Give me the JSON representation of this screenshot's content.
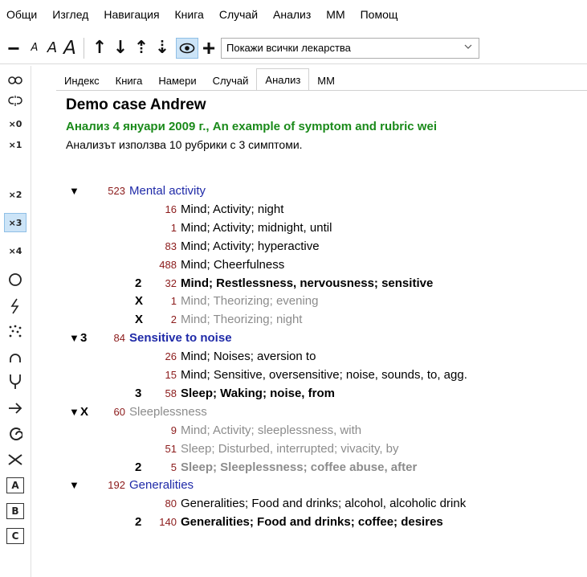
{
  "menu": [
    "Общи",
    "Изглед",
    "Навигация",
    "Книга",
    "Случай",
    "Анализ",
    "ММ",
    "Помощ"
  ],
  "toolbar": {
    "font_small": "A",
    "font_medium": "A",
    "font_large": "A",
    "filter_value": "Покажи всички лекарства",
    "icons": [
      "minus-icon",
      "font-small-icon",
      "font-medium-icon",
      "font-large-icon",
      "arrow-up-icon",
      "arrow-down-icon",
      "arrow-up-dotted-icon",
      "arrow-down-dotted-icon",
      "eye-icon",
      "plus-icon"
    ]
  },
  "leftbar": {
    "x0": "×0",
    "x1": "×1",
    "x2": "×2",
    "x3": "×3",
    "x4": "×4",
    "box_a": "A",
    "box_b": "B",
    "box_c": "C"
  },
  "tabs": [
    "Индекс",
    "Книга",
    "Намери",
    "Случай",
    "Анализ",
    "ММ"
  ],
  "active_tab": "Анализ",
  "case": {
    "title": "Demo case Andrew",
    "analysis": "Анализ 4 януари 2009 г., An example of symptom and rubric wei",
    "usage": "Анализът използва 10 рубрики с 3 симптоми."
  },
  "symptoms": [
    {
      "triangle": "▼",
      "weight": "",
      "count": "523",
      "label": "Mental activity",
      "style": "blue",
      "rubrics": [
        {
          "weight": "",
          "count": "16",
          "label": "Mind; Activity; night",
          "style": "normal"
        },
        {
          "weight": "",
          "count": "1",
          "label": "Mind; Activity; midnight, until",
          "style": "normal"
        },
        {
          "weight": "",
          "count": "83",
          "label": "Mind; Activity; hyperactive",
          "style": "normal"
        },
        {
          "weight": "",
          "count": "488",
          "label": "Mind; Cheerfulness",
          "style": "normal"
        },
        {
          "weight": "2",
          "count": "32",
          "label": "Mind; Restlessness, nervousness; sensitive",
          "style": "bold"
        },
        {
          "weight": "X",
          "count": "1",
          "label": "Mind; Theorizing; evening",
          "style": "grey"
        },
        {
          "weight": "X",
          "count": "2",
          "label": "Mind; Theorizing; night",
          "style": "grey"
        }
      ]
    },
    {
      "triangle": "▼",
      "weight": "3",
      "count": "84",
      "label": "Sensitive to noise",
      "style": "blue-bold",
      "rubrics": [
        {
          "weight": "",
          "count": "26",
          "label": "Mind; Noises; aversion to",
          "style": "normal"
        },
        {
          "weight": "",
          "count": "15",
          "label": "Mind; Sensitive, oversensitive; noise, sounds, to, agg.",
          "style": "normal"
        },
        {
          "weight": "3",
          "count": "58",
          "label": "Sleep; Waking; noise, from",
          "style": "bold"
        }
      ]
    },
    {
      "triangle": "▼",
      "weight": "X",
      "count": "60",
      "label": "Sleeplessness",
      "style": "grey",
      "rubrics": [
        {
          "weight": "",
          "count": "9",
          "label": "Mind; Activity; sleeplessness, with",
          "style": "grey"
        },
        {
          "weight": "",
          "count": "51",
          "label": "Sleep; Disturbed, interrupted; vivacity, by",
          "style": "grey"
        },
        {
          "weight": "2",
          "count": "5",
          "label": "Sleep; Sleeplessness; coffee abuse, after",
          "style": "grey-bold"
        }
      ]
    },
    {
      "triangle": "▼",
      "weight": "",
      "count": "192",
      "label": "Generalities",
      "style": "blue",
      "rubrics": [
        {
          "weight": "",
          "count": "80",
          "label": "Generalities; Food and drinks; alcohol, alcoholic drink",
          "style": "normal"
        },
        {
          "weight": "2",
          "count": "140",
          "label": "Generalities; Food and drinks; coffee; desires",
          "style": "bold"
        }
      ]
    }
  ]
}
